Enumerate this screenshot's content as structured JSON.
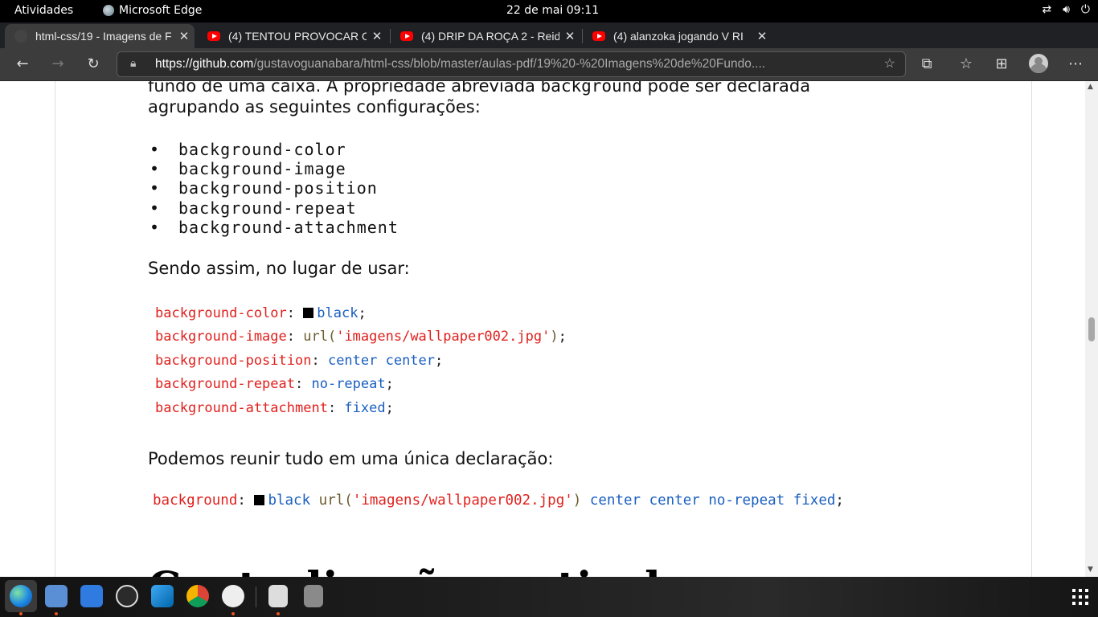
{
  "system_bar": {
    "activities": "Atividades",
    "app_name": "Microsoft Edge",
    "clock": "22 de mai  09:11"
  },
  "tabs": [
    {
      "title": "html-css/19 - Imagens de F",
      "icon": "github-icon",
      "active": true
    },
    {
      "title": "(4) TENTOU PROVOCAR O",
      "icon": "youtube-icon",
      "active": false
    },
    {
      "title": "(4) DRIP DA ROÇA 2 - Reid",
      "icon": "youtube-icon",
      "active": false
    },
    {
      "title": "(4) alanzoka jogando V RI",
      "icon": "youtube-icon",
      "active": false
    }
  ],
  "address_bar": {
    "url_host": "https://github.com",
    "url_path": "/gustavoguanabara/html-css/blob/master/aulas-pdf/19%20-%20Imagens%20de%20Fundo...."
  },
  "doc": {
    "intro_line1_pre": "fundo de uma caixa. A propriedade abreviada ",
    "intro_line1_code": "background",
    "intro_line1_post": " pode ser declarada",
    "intro_line2": "agrupando as seguintes configurações:",
    "list": [
      "background-color",
      "background-image",
      "background-position",
      "background-repeat",
      "background-attachment"
    ],
    "para_instead": "Sendo assim, no lugar de usar:",
    "code_block": [
      {
        "prop": "background-color",
        "sep": ": ",
        "swatch": true,
        "v1": "black",
        "tail": ";"
      },
      {
        "prop": "background-image",
        "sep": ": ",
        "fn": "url(",
        "str": "'imagens/wallpaper002.jpg'",
        "fn_close": ")",
        "tail": ";"
      },
      {
        "prop": "background-position",
        "sep": ": ",
        "v1": "center center",
        "tail": ";"
      },
      {
        "prop": "background-repeat",
        "sep": ": ",
        "v1": "no-repeat",
        "tail": ";"
      },
      {
        "prop": "background-attachment",
        "sep": ": ",
        "v1": "fixed",
        "tail": ";"
      }
    ],
    "para_join": "Podemos reunir tudo em uma única declaração:",
    "shorthand": {
      "prop": "background",
      "sep": ": ",
      "v1": "black",
      "fn": "url(",
      "str": "'imagens/wallpaper002.jpg'",
      "fn_close": ")",
      "v2": "center center no-repeat fixed",
      "tail": ";"
    },
    "partial_heading": "Centralização vertical"
  },
  "colors": {
    "css_property": "#e0211d",
    "css_value": "#1a5fc0",
    "ubuntu_accent": "#e95420"
  },
  "dock": [
    "edge-icon",
    "files-icon",
    "mail-icon",
    "github-desktop-icon",
    "vscode-icon",
    "chrome-icon",
    "clock-icon",
    "usb-drive-icon",
    "trash-icon"
  ]
}
